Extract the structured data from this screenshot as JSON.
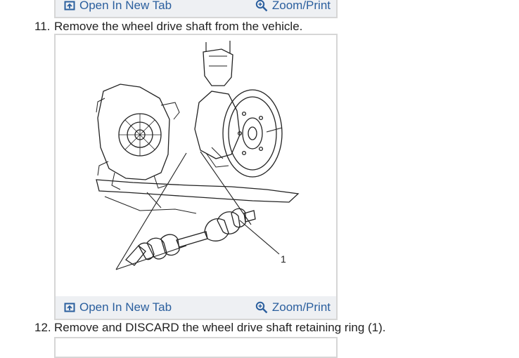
{
  "figure_toolbar": {
    "open_label": "Open In New Tab",
    "zoom_label": "Zoom/Print"
  },
  "steps": [
    {
      "number": "11.",
      "text": "Remove the wheel drive shaft from the vehicle."
    },
    {
      "number": "12.",
      "text": "Remove and DISCARD the wheel drive shaft retaining ring (1)."
    }
  ],
  "figure": {
    "callout": "1"
  },
  "colors": {
    "link": "#2b5f9e",
    "toolbar_bg": "#eef0f3",
    "frame_border": "#d6d6d6"
  }
}
